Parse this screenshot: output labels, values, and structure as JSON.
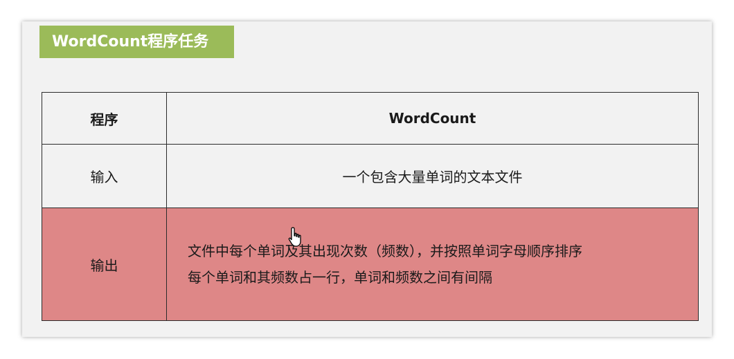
{
  "title": "WordCount程序任务",
  "table": {
    "header": {
      "label": "程序",
      "value": "WordCount"
    },
    "input": {
      "label": "输入",
      "value": "一个包含大量单词的文本文件"
    },
    "output": {
      "label": "输出",
      "lines": [
        "文件中每个单词及其出现次数（频数），并按照单词字母顺序排序",
        "每个单词和其频数占一行，单词和频数之间有间隔"
      ]
    }
  },
  "colors": {
    "banner": "#9bbb59",
    "output_row": "#de8787",
    "slide_bg": "#f2f2f2"
  },
  "icons": {
    "cursor": "hand-pointer-icon"
  }
}
